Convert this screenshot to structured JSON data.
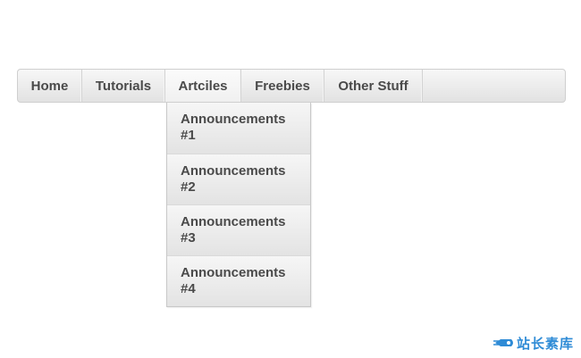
{
  "nav": {
    "items": [
      {
        "label": "Home"
      },
      {
        "label": "Tutorials"
      },
      {
        "label": "Artciles"
      },
      {
        "label": "Freebies"
      },
      {
        "label": "Other Stuff"
      }
    ],
    "active_index": 2
  },
  "dropdown": {
    "items": [
      {
        "label": "Announcements #1"
      },
      {
        "label": "Announcements #2"
      },
      {
        "label": "Announcements #3"
      },
      {
        "label": "Announcements #4"
      }
    ]
  },
  "watermark": {
    "text": "站长素库",
    "icon": "rocket-icon",
    "color": "#2e8bd6"
  },
  "colors": {
    "text": "#4a4a4a",
    "border": "#cfcfcf"
  }
}
